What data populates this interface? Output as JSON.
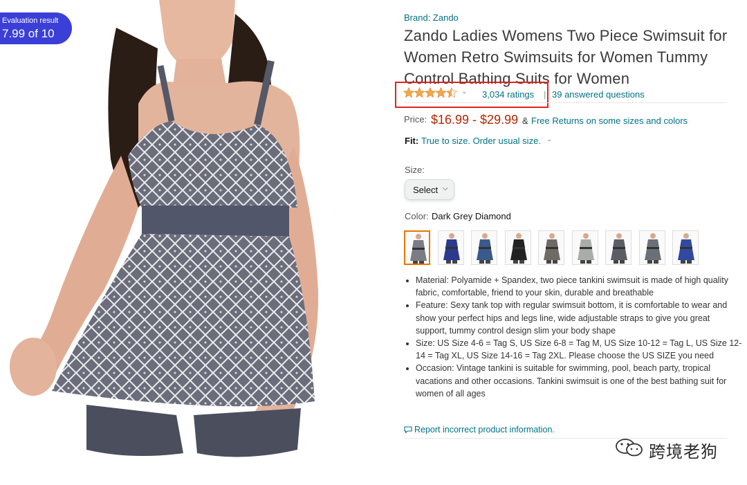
{
  "badge": {
    "label": "Evaluation result",
    "value": "7.99 of 10"
  },
  "product": {
    "brand": "Brand: Zando",
    "title": "Zando Ladies Womens Two Piece Swimsuit for Women Retro Swimsuits for Women Tummy Control Bathing Suits for Women",
    "rating": 4.5,
    "ratings_text": "3,034 ratings",
    "separator": "|",
    "answered_text": "39 answered questions",
    "price_label": "Price:",
    "price_value": "$16.99 - $29.99",
    "price_amp": "&",
    "free_returns": "Free Returns on some sizes and colors",
    "fit_label": "Fit:",
    "fit_value": "True to size. Order usual size.",
    "size_label": "Size:",
    "size_select": "Select",
    "color_label": "Color:",
    "color_value": "Dark Grey Diamond",
    "swatch_colors": [
      "#7a7c86",
      "#2b3a8f",
      "#3a5a8c",
      "#222222",
      "#6e6a66",
      "#a8adaa",
      "#5c5e66",
      "#6a6f78",
      "#2f4aa0"
    ],
    "bullets": [
      "Material: Polyamide + Spandex, two piece tankini swimsuit is made of high quality fabric, comfortable, friend to your skin, durable and breathable",
      "Feature: Sexy tank top with regular swimsuit bottom, it is comfortable to wear and show your perfect hips and legs line, wide adjustable straps to give you great support, tummy control design slim your body shape",
      "Size: US Size 4-6 = Tag S, US Size 6-8 = Tag M, US Size 10-12 = Tag L, US Size 12-14 = Tag XL, US Size 14-16 = Tag 2XL. Please choose the US SIZE you need",
      "Occasion: Vintage tankini is suitable for swimming, pool, beach party, tropical vacations and other occasions. Tankini swimsuit is one of the best bathing suit for women of all ages"
    ],
    "report_text": "Report incorrect product information."
  },
  "watermark": {
    "text": "跨境老狗",
    "icon": "wechat-icon"
  },
  "colors": {
    "link": "#007185",
    "price": "#b12704",
    "star": "#f3a847",
    "highlight": "#e2231a",
    "badge": "#3b3fd8"
  }
}
